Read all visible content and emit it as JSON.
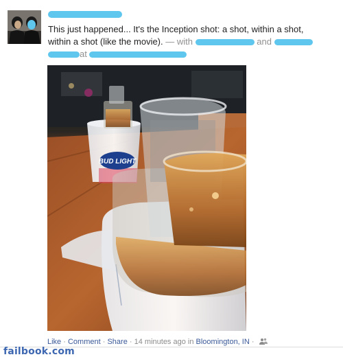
{
  "post": {
    "author_name": "",
    "story": {
      "line1": "This just happened... It's the Inception shot: a shot, within a shot,",
      "line2": "within a shot (like the movie).",
      "with_prefix": "— with",
      "and_word": "and",
      "at_word": "at"
    },
    "photo_text": {
      "bud_light_logo": "BUD LIGHT"
    },
    "actions": {
      "like": "Like",
      "comment": "Comment",
      "share": "Share",
      "time": "14 minutes ago",
      "in_word": "in",
      "location": "Bloomington, IN",
      "separator": "·"
    },
    "privacy_icon": "friends-icon"
  },
  "watermark": {
    "text": "failbook.com"
  },
  "colors": {
    "link": "#3b5998",
    "censor_blur": "#5fc6ee",
    "meta_text": "#8b8b8b",
    "watermark": "#3e67b1"
  }
}
